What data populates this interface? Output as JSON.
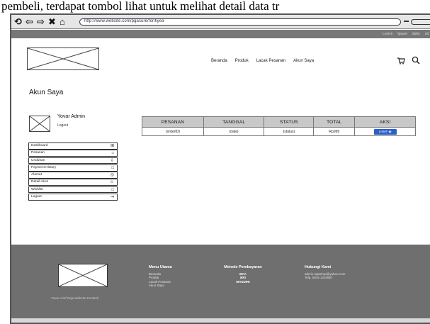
{
  "caption": "pembeli, terdapat tombol lihat untuk melihat detail data tr",
  "browser": {
    "address": "http://www.website.com/pgasure/fonfiyea"
  },
  "top_links": [
    "Lorem",
    "Ipsum",
    "dolor",
    "sit"
  ],
  "nav": {
    "items": [
      "Beranda",
      "Produk",
      "Lacak Pesanan",
      "Akun Saya"
    ],
    "cart_icon": "cart-icon",
    "search_icon": "search-icon"
  },
  "page": {
    "title": "Akun Saya"
  },
  "user": {
    "name": "Yovar Admin",
    "logout": "Logout"
  },
  "sidebar": {
    "items": [
      {
        "label": "Dashboard",
        "icon": "dashboard-icon",
        "glyph": "⊞"
      },
      {
        "label": "Pesanan",
        "icon": "cart-icon",
        "glyph": "⌂"
      },
      {
        "label": "Unduhan",
        "icon": "download-icon",
        "glyph": "⇩"
      },
      {
        "label": "Payment History",
        "icon": "receipt-icon",
        "glyph": "□"
      },
      {
        "label": "Alamat",
        "icon": "location-icon",
        "glyph": "◎"
      },
      {
        "label": "Detail Akun",
        "icon": "user-icon",
        "glyph": "☺"
      },
      {
        "label": "Wishlist",
        "icon": "document-icon",
        "glyph": "□"
      },
      {
        "label": "Logout",
        "icon": "logout-icon",
        "glyph": "⇥"
      }
    ]
  },
  "orders_table": {
    "headers": [
      "PESANAN",
      "TANGGAL",
      "STATUS",
      "TOTAL",
      "AKSI"
    ],
    "rows": [
      {
        "order": "{orderID}",
        "date": "{date}",
        "status": "{status}",
        "total": "Rp999",
        "action": "LIHAT"
      }
    ]
  },
  "footer": {
    "copyright": "Yovar Arief Raja Website Pembeli",
    "col1": {
      "title": "Menu Utama",
      "items": [
        "Beranda",
        "Produk",
        "Lacak Pesanan",
        "Akun Saya"
      ]
    },
    "col2": {
      "title": "Metode Pembayaran",
      "items": [
        "BCA",
        "BRI",
        "MANDIRI"
      ]
    },
    "col3": {
      "title": "Hubungi Kami",
      "items": [
        "admin.rajashop@yahoo.com",
        "Telp. 0819 1234567"
      ]
    }
  },
  "colors": {
    "accent_button": "#2e5fc8",
    "footer_bg": "#6f6f6f",
    "table_header_bg": "#c8c8c8"
  }
}
